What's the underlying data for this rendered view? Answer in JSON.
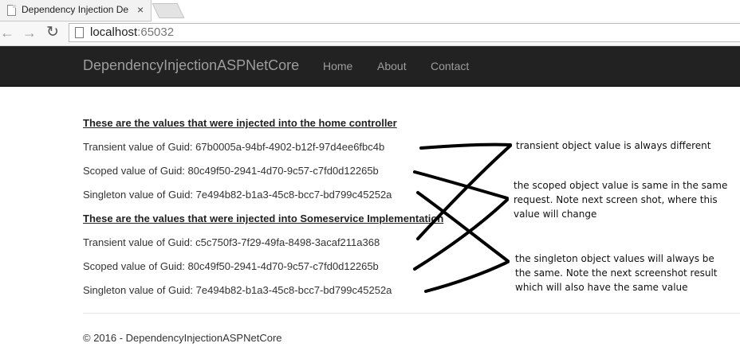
{
  "browser": {
    "tab_title": "Dependency Injection Der",
    "tab_close": "×",
    "url_host": "localhost",
    "url_port": ":65032",
    "back_glyph": "←",
    "forward_glyph": "→",
    "reload_glyph": "↻",
    "icons": [
      "page-icon",
      "back-arrow-icon",
      "forward-arrow-icon",
      "reload-icon",
      "close-icon"
    ]
  },
  "navbar": {
    "brand": "DependencyInjectionASPNetCore",
    "links": [
      "Home",
      "About",
      "Contact"
    ],
    "background": "#222222",
    "link_color": "#9d9d9d"
  },
  "content": {
    "home_heading": "These are the values that were injected into the home controller",
    "home_lines": [
      "Transient value of Guid: 67b0005a-94bf-4902-b12f-97d4ee6fbc4b",
      "Scoped value of Guid: 80c49f50-2941-4d70-9c57-c7fd0d12265b",
      "Singleton value of Guid: 7e494b82-b1a3-45c8-bcc7-bd799c45252a"
    ],
    "service_heading": "These are the values that were injected into Someservice Implementation",
    "service_lines": [
      "Transient value of Guid: c5c750f3-7f29-49fa-8498-3acaf211a368",
      "Scoped value of Guid: 80c49f50-2941-4d70-9c57-c7fd0d12265b",
      "Singleton value of Guid: 7e494b82-b1a3-45c8-bcc7-bd799c45252a"
    ]
  },
  "footer": {
    "text": "© 2016 - DependencyInjectionASPNetCore"
  },
  "annotations": {
    "transient_note": "transient object value is always different",
    "scoped_note": [
      "the scoped object value is same in the same",
      "request. Note next screen shot, where this",
      "value will change"
    ],
    "singleton_note": [
      "the singleton object values will always be",
      "the same. Note the next screenshot result",
      "which will also have the same value"
    ],
    "stroke_color": "#000000"
  }
}
